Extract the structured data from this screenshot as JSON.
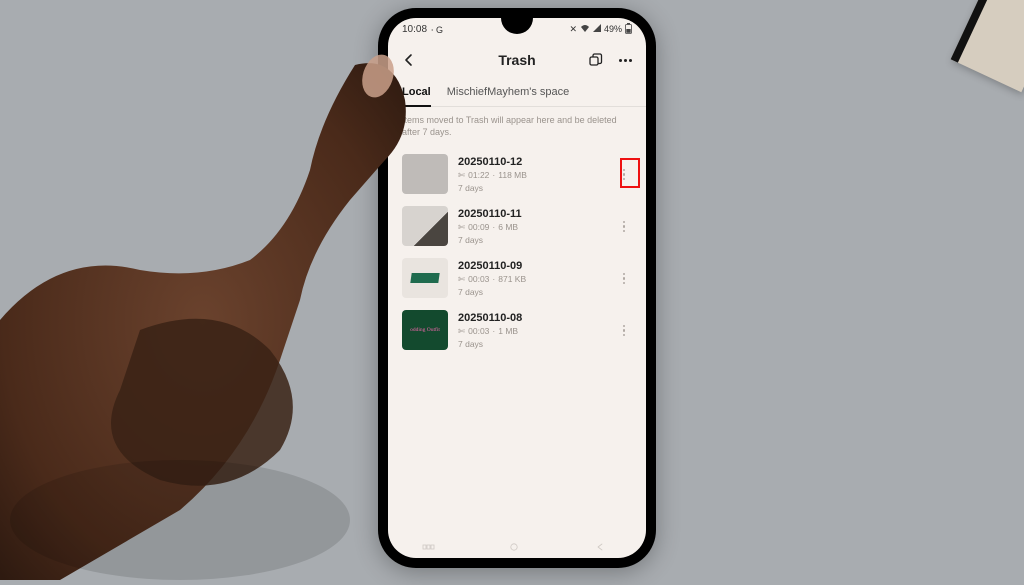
{
  "status": {
    "time": "10:08",
    "net": "G",
    "battery": "49%"
  },
  "header": {
    "title": "Trash"
  },
  "tabs": {
    "local": "Local",
    "cloud": "MischiefMayhem's space"
  },
  "hint": "Items moved to Trash will appear here and be deleted after 7 days.",
  "items": [
    {
      "title": "20250110-12",
      "duration": "01:22",
      "size": "118 MB",
      "days": "7 days"
    },
    {
      "title": "20250110-11",
      "duration": "00:09",
      "size": "6 MB",
      "days": "7 days"
    },
    {
      "title": "20250110-09",
      "duration": "00:03",
      "size": "871 KB",
      "days": "7 days"
    },
    {
      "title": "20250110-08",
      "duration": "00:03",
      "size": "1 MB",
      "days": "7 days"
    }
  ],
  "thumb4_text": "odding Outfit"
}
